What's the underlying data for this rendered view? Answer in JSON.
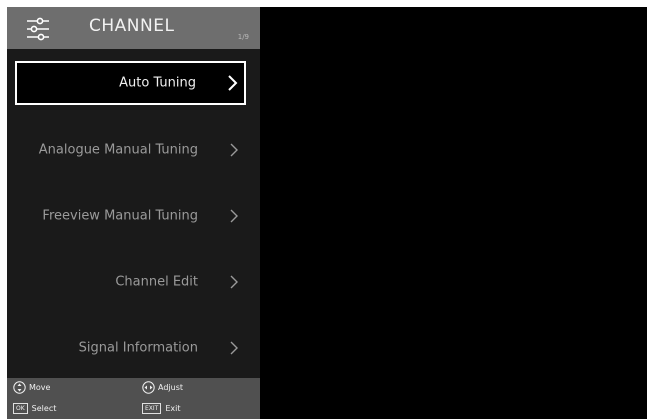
{
  "header": {
    "icon": "settings-sliders-icon",
    "title": "CHANNEL",
    "page_indicator": "1/9"
  },
  "menu": {
    "items": [
      {
        "label": "Auto Tuning",
        "selected": true
      },
      {
        "label": "Analogue Manual Tuning",
        "selected": false
      },
      {
        "label": "Freeview Manual Tuning",
        "selected": false
      },
      {
        "label": "Channel Edit",
        "selected": false
      },
      {
        "label": "Signal Information",
        "selected": false
      }
    ]
  },
  "footer": {
    "move_label": "Move",
    "adjust_label": "Adjust",
    "select_key": "OK",
    "select_label": "Select",
    "exit_key": "EXIT",
    "exit_label": "Exit"
  },
  "colors": {
    "header_bg": "#6e6e6e",
    "panel_bg": "#1a1a1a",
    "footer_bg": "#505050",
    "selection_border": "#ffffff"
  }
}
